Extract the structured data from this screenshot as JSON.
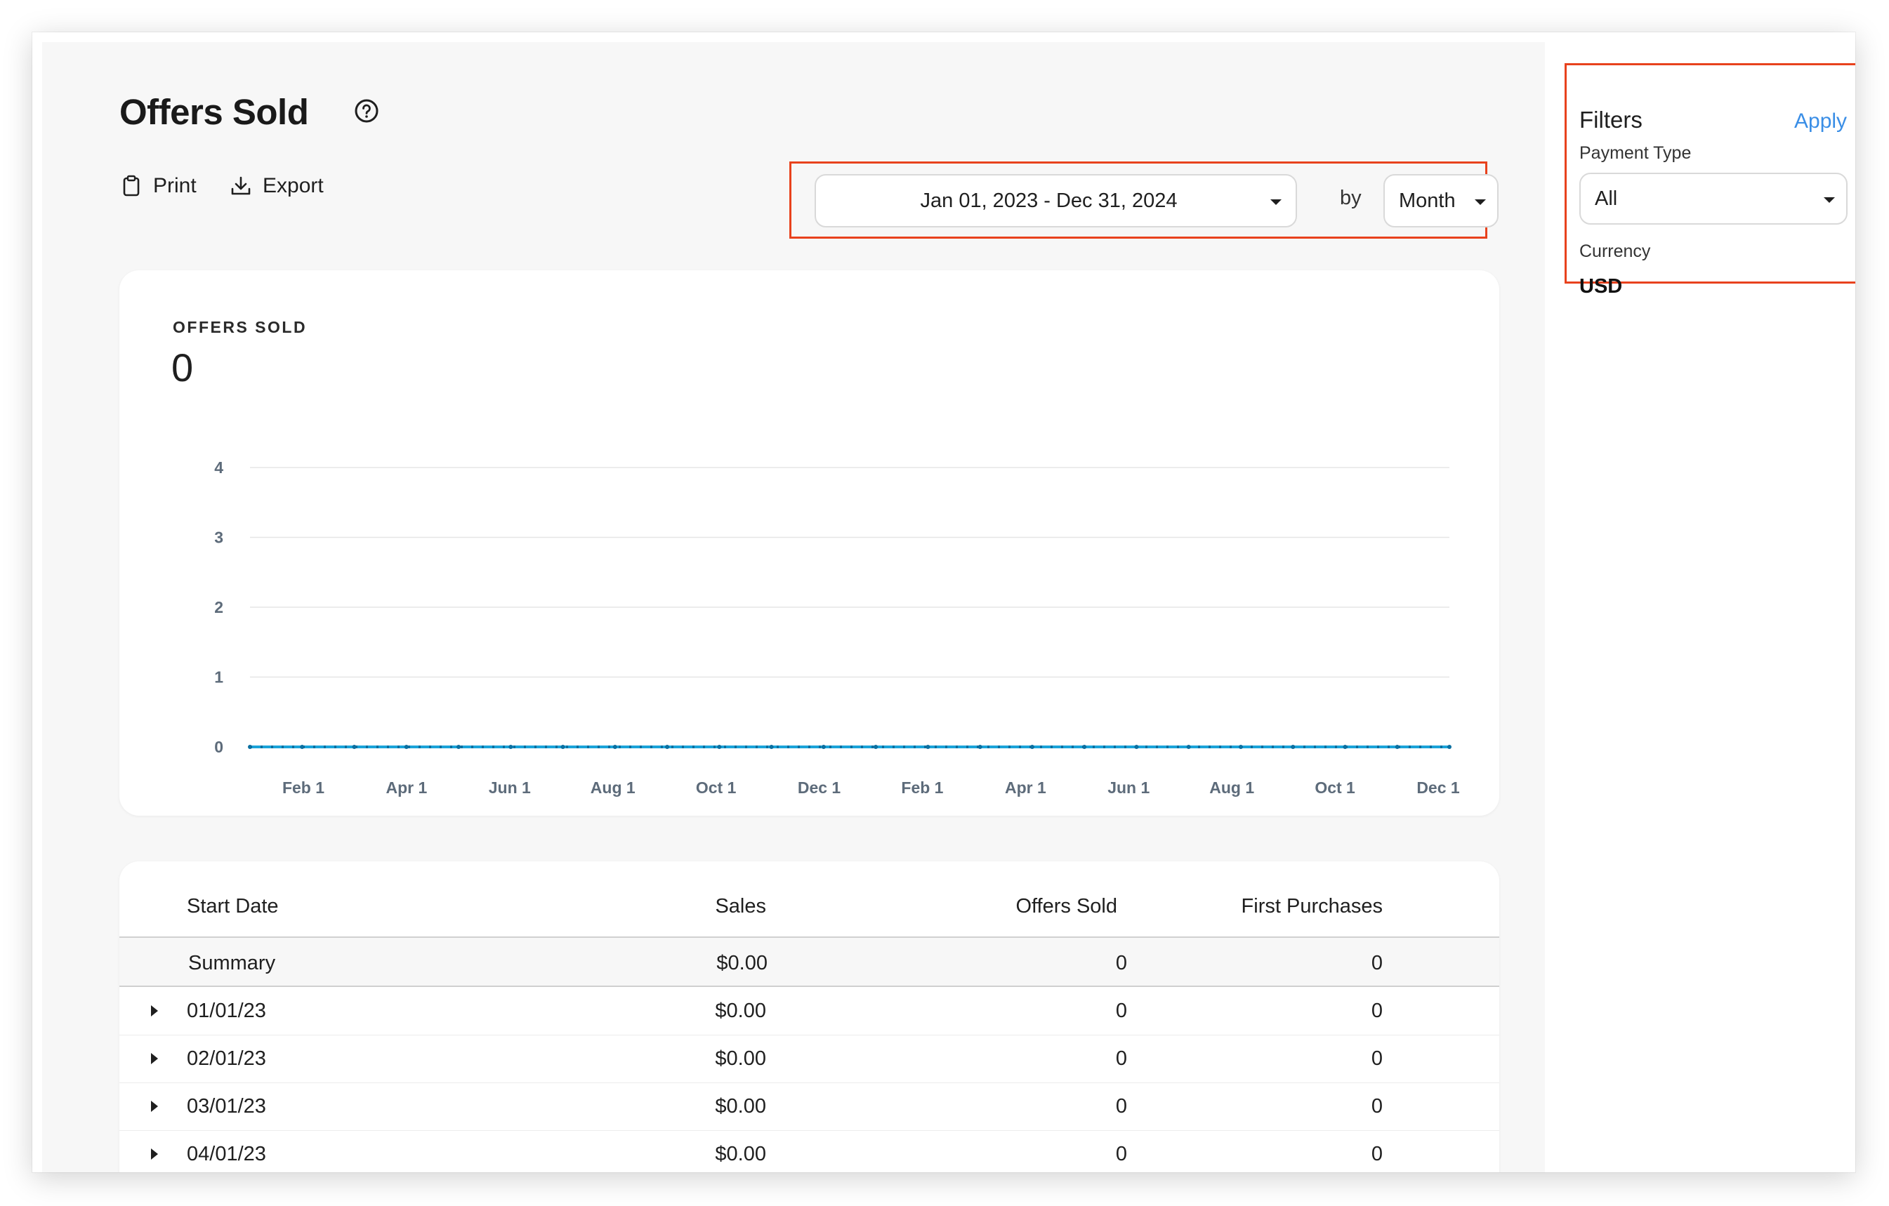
{
  "page": {
    "title": "Offers Sold"
  },
  "toolbar": {
    "print_label": "Print",
    "export_label": "Export"
  },
  "date_range": {
    "value": "Jan 01, 2023 - Dec 31, 2024",
    "by_label": "by",
    "granularity": "Month"
  },
  "summary_card": {
    "label": "OFFERS SOLD",
    "total": "0"
  },
  "chart_data": {
    "type": "line",
    "title": "",
    "xlabel": "",
    "ylabel": "",
    "x_ticks": [
      "Feb 1",
      "Apr 1",
      "Jun 1",
      "Aug 1",
      "Oct 1",
      "Dec 1",
      "Feb 1",
      "Apr 1",
      "Jun 1",
      "Aug 1",
      "Oct 1",
      "Dec 1"
    ],
    "y_ticks": [
      "0",
      "1",
      "2",
      "3",
      "4"
    ],
    "ylim": [
      0,
      4
    ],
    "grid": true,
    "series": [
      {
        "color": "#1aa3d9",
        "style": "dotted",
        "values": [
          0,
          0,
          0,
          0,
          0,
          0,
          0,
          0,
          0,
          0,
          0,
          0,
          0,
          0,
          0,
          0,
          0,
          0,
          0,
          0,
          0,
          0,
          0,
          0
        ]
      }
    ]
  },
  "table": {
    "headers": {
      "start_date": "Start Date",
      "sales": "Sales",
      "offers_sold": "Offers Sold",
      "first_purchases": "First Purchases"
    },
    "summary": {
      "label": "Summary",
      "sales": "$0.00",
      "offers_sold": "0",
      "first_purchases": "0"
    },
    "rows": [
      {
        "start_date": "01/01/23",
        "sales": "$0.00",
        "offers_sold": "0",
        "first_purchases": "0"
      },
      {
        "start_date": "02/01/23",
        "sales": "$0.00",
        "offers_sold": "0",
        "first_purchases": "0"
      },
      {
        "start_date": "03/01/23",
        "sales": "$0.00",
        "offers_sold": "0",
        "first_purchases": "0"
      },
      {
        "start_date": "04/01/23",
        "sales": "$0.00",
        "offers_sold": "0",
        "first_purchases": "0"
      }
    ]
  },
  "filters": {
    "title": "Filters",
    "apply_label": "Apply",
    "payment_type_label": "Payment Type",
    "payment_type_value": "All",
    "currency_label": "Currency",
    "currency_value": "USD"
  },
  "colors": {
    "highlight": "#e8421d",
    "accent": "#3a8ee6",
    "series": "#1aa3d9"
  }
}
